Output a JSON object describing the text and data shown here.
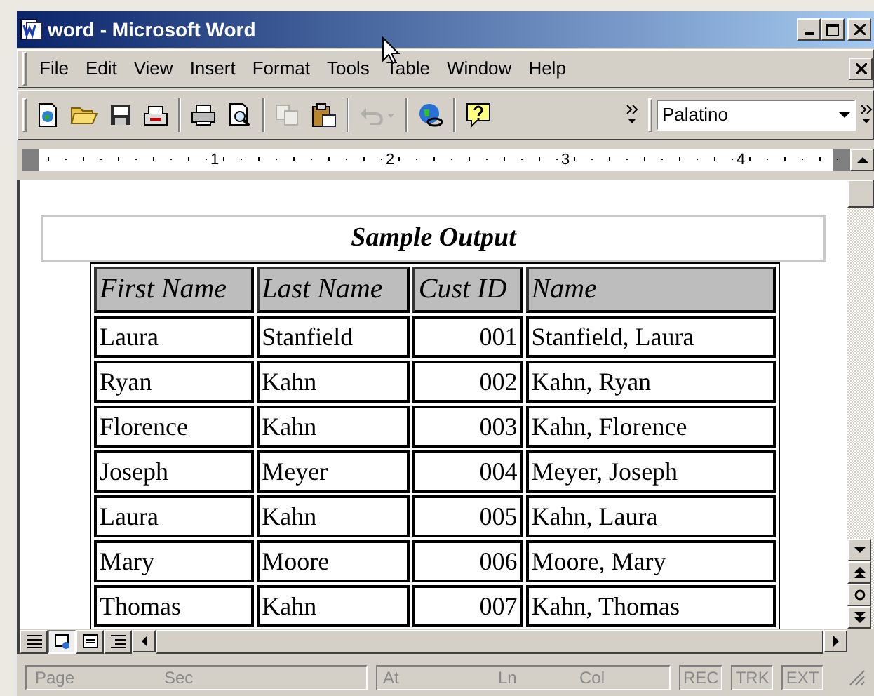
{
  "window": {
    "title": "word - Microsoft Word"
  },
  "menu": [
    "File",
    "Edit",
    "View",
    "Insert",
    "Format",
    "Tools",
    "Table",
    "Window",
    "Help"
  ],
  "toolbar": {
    "buttons": [
      {
        "kind": "new",
        "disabled": false
      },
      {
        "kind": "open",
        "disabled": false
      },
      {
        "kind": "save",
        "disabled": false
      },
      {
        "kind": "mail",
        "disabled": false
      },
      {
        "kind": "print",
        "disabled": false
      },
      {
        "kind": "preview",
        "disabled": false
      },
      {
        "kind": "copy",
        "disabled": true
      },
      {
        "kind": "paste",
        "disabled": false
      },
      {
        "kind": "undo",
        "disabled": true
      },
      {
        "kind": "web",
        "disabled": false
      },
      {
        "kind": "help",
        "disabled": false
      }
    ],
    "font": "Palatino"
  },
  "ruler": [
    "1",
    "2",
    "3",
    "4"
  ],
  "document": {
    "heading": "Sample Output",
    "table": {
      "columns": [
        "First Name",
        "Last Name",
        "Cust ID",
        "Name"
      ],
      "rows": [
        [
          "Laura",
          "Stanfield",
          "001",
          "Stanfield, Laura"
        ],
        [
          "Ryan",
          "Kahn",
          "002",
          "Kahn, Ryan"
        ],
        [
          "Florence",
          "Kahn",
          "003",
          "Kahn, Florence"
        ],
        [
          "Joseph",
          "Meyer",
          "004",
          "Meyer, Joseph"
        ],
        [
          "Laura",
          "Kahn",
          "005",
          "Kahn, Laura"
        ],
        [
          "Mary",
          "Moore",
          "006",
          "Moore, Mary"
        ],
        [
          "Thomas",
          "Kahn",
          "007",
          "Kahn, Thomas"
        ]
      ]
    }
  },
  "view_buttons": [
    {
      "kind": "normal",
      "selected": false
    },
    {
      "kind": "web",
      "selected": true
    },
    {
      "kind": "print",
      "selected": false
    },
    {
      "kind": "outline",
      "selected": false
    }
  ],
  "status_bar": {
    "fields": [
      "Page",
      "Sec",
      "At",
      "Ln",
      "Col"
    ],
    "modes": [
      {
        "label": "REC",
        "active": false
      },
      {
        "label": "TRK",
        "active": false
      },
      {
        "label": "EXT",
        "active": false
      }
    ]
  }
}
